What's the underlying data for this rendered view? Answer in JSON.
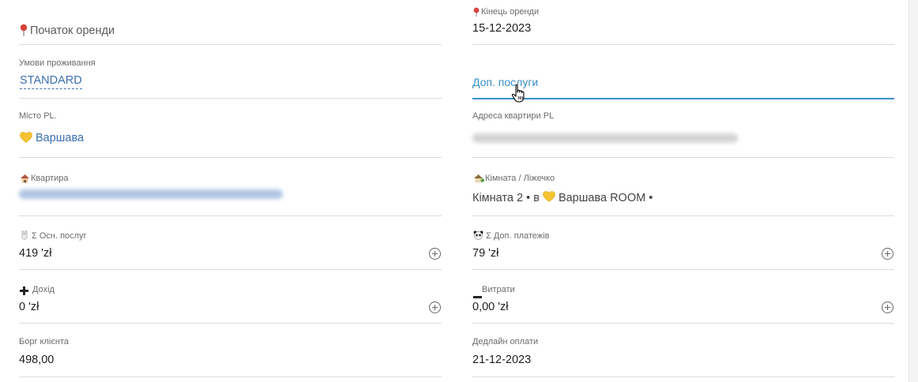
{
  "fields": {
    "rent_start": {
      "icon": "pin-icon",
      "placeholder": "Початок оренди"
    },
    "rent_end": {
      "icon": "pin-icon",
      "label": "Кінець оренди",
      "value": "15-12-2023"
    },
    "living_terms": {
      "label": "Умови проживання",
      "value": "STANDARD"
    },
    "extra_services": {
      "placeholder": "Доп. послуги"
    },
    "city": {
      "label": "Місто PL.",
      "icon": "yellow-heart-icon",
      "value": "Варшава"
    },
    "address": {
      "label": "Адреса квартири PL",
      "value_blurred": true
    },
    "apartment": {
      "icon": "house-icon",
      "label": "Квартира",
      "value_blurred": true
    },
    "room": {
      "icon": "house-garden-icon",
      "label": "Кімната / Ліжечко",
      "value_prefix": "Кімната 2 • в",
      "value_heart_icon": "yellow-heart-icon",
      "value_suffix": "Варшава ROOM •"
    },
    "sum_main": {
      "icon": "rabbit-icon",
      "label": "Σ Осн. послуг",
      "value": "419 'zł"
    },
    "sum_extra": {
      "icon": "panda-icon",
      "label": "Σ Доп. платежів",
      "value": "79 'zł"
    },
    "income": {
      "icon": "plus-icon",
      "label": "Дохід",
      "value": "0 'zł"
    },
    "expenses": {
      "icon": "minus-icon",
      "label": "Витрати",
      "value": "0,00 'zł"
    },
    "client_debt": {
      "label": "Борг клієнта",
      "value": "498,00"
    },
    "payment_deadline": {
      "label": "Дедлайн оплати",
      "value": "21-12-2023"
    }
  },
  "colors": {
    "link": "#3c6fb0",
    "focus": "#3a8fc7",
    "divider": "#dcdcdc",
    "pin": "#d9433d",
    "heart": "#f4c430"
  }
}
